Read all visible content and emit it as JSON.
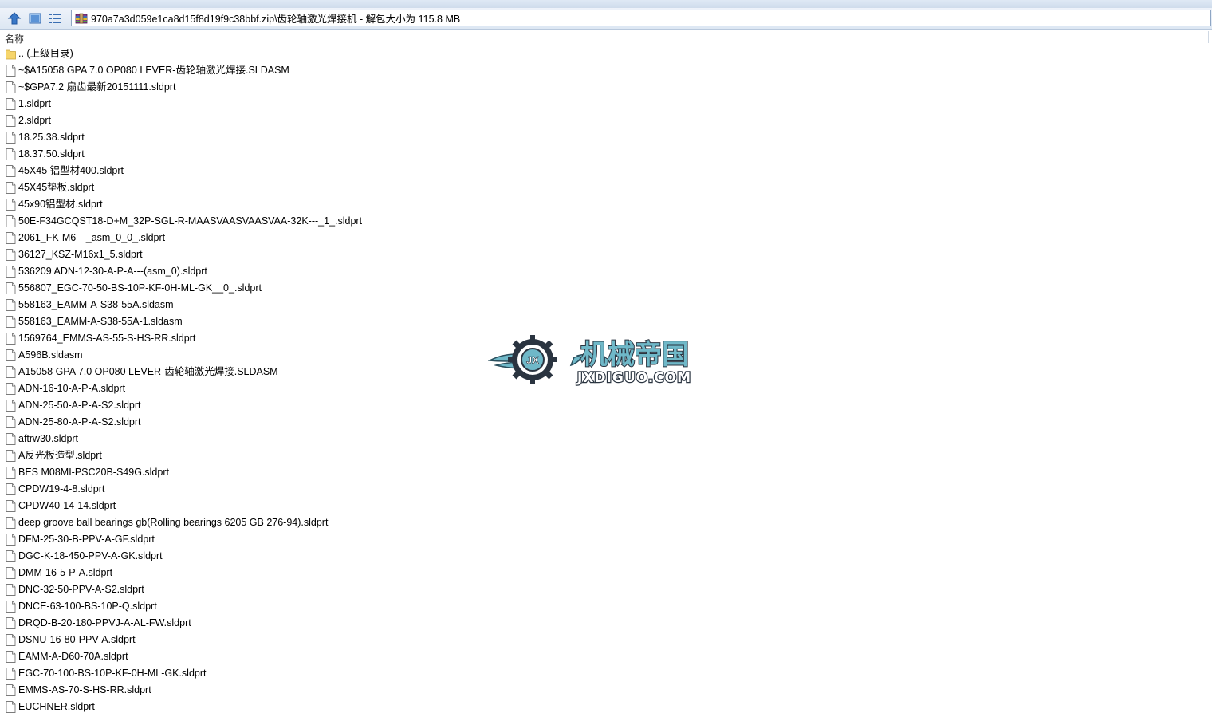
{
  "window": {
    "address_path": "970a7a3d059e1ca8d15f8d19f9c38bbf.zip\\齿轮轴激光焊接机 - 解包大小为 115.8 MB"
  },
  "list_header": {
    "name_column": "名称"
  },
  "files": [
    {
      "name": ".. (上级目录)",
      "type": "folder"
    },
    {
      "name": "~$A15058 GPA 7.0 OP080 LEVER-齿轮轴激光焊接.SLDASM",
      "type": "file"
    },
    {
      "name": "~$GPA7.2 扇齿最新20151111.sldprt",
      "type": "file"
    },
    {
      "name": "1.sldprt",
      "type": "file"
    },
    {
      "name": "2.sldprt",
      "type": "file"
    },
    {
      "name": "18.25.38.sldprt",
      "type": "file"
    },
    {
      "name": "18.37.50.sldprt",
      "type": "file"
    },
    {
      "name": "45X45 铝型材400.sldprt",
      "type": "file"
    },
    {
      "name": "45X45垫板.sldprt",
      "type": "file"
    },
    {
      "name": "45x90铝型材.sldprt",
      "type": "file"
    },
    {
      "name": "50E-F34GCQST18-D+M_32P-SGL-R-MAASVAASVAASVAA-32K---_1_.sldprt",
      "type": "file"
    },
    {
      "name": "2061_FK-M6---_asm_0_0_.sldprt",
      "type": "file"
    },
    {
      "name": "36127_KSZ-M16x1_5.sldprt",
      "type": "file"
    },
    {
      "name": "536209 ADN-12-30-A-P-A---(asm_0).sldprt",
      "type": "file"
    },
    {
      "name": "556807_EGC-70-50-BS-10P-KF-0H-ML-GK__0_.sldprt",
      "type": "file"
    },
    {
      "name": "558163_EAMM-A-S38-55A.sldasm",
      "type": "file"
    },
    {
      "name": "558163_EAMM-A-S38-55A-1.sldasm",
      "type": "file"
    },
    {
      "name": "1569764_EMMS-AS-55-S-HS-RR.sldprt",
      "type": "file"
    },
    {
      "name": "A596B.sldasm",
      "type": "file"
    },
    {
      "name": "A15058 GPA 7.0 OP080 LEVER-齿轮轴激光焊接.SLDASM",
      "type": "file"
    },
    {
      "name": "ADN-16-10-A-P-A.sldprt",
      "type": "file"
    },
    {
      "name": "ADN-25-50-A-P-A-S2.sldprt",
      "type": "file"
    },
    {
      "name": "ADN-25-80-A-P-A-S2.sldprt",
      "type": "file"
    },
    {
      "name": "aftrw30.sldprt",
      "type": "file"
    },
    {
      "name": "A反光板造型.sldprt",
      "type": "file"
    },
    {
      "name": "BES M08MI-PSC20B-S49G.sldprt",
      "type": "file"
    },
    {
      "name": "CPDW19-4-8.sldprt",
      "type": "file"
    },
    {
      "name": "CPDW40-14-14.sldprt",
      "type": "file"
    },
    {
      "name": "deep groove ball bearings gb(Rolling bearings 6205 GB 276-94).sldprt",
      "type": "file"
    },
    {
      "name": "DFM-25-30-B-PPV-A-GF.sldprt",
      "type": "file"
    },
    {
      "name": "DGC-K-18-450-PPV-A-GK.sldprt",
      "type": "file"
    },
    {
      "name": "DMM-16-5-P-A.sldprt",
      "type": "file"
    },
    {
      "name": "DNC-32-50-PPV-A-S2.sldprt",
      "type": "file"
    },
    {
      "name": "DNCE-63-100-BS-10P-Q.sldprt",
      "type": "file"
    },
    {
      "name": "DRQD-B-20-180-PPVJ-A-AL-FW.sldprt",
      "type": "file"
    },
    {
      "name": "DSNU-16-80-PPV-A.sldprt",
      "type": "file"
    },
    {
      "name": "EAMM-A-D60-70A.sldprt",
      "type": "file"
    },
    {
      "name": "EGC-70-100-BS-10P-KF-0H-ML-GK.sldprt",
      "type": "file"
    },
    {
      "name": "EMMS-AS-70-S-HS-RR.sldprt",
      "type": "file"
    },
    {
      "name": "EUCHNER.sldprt",
      "type": "file"
    }
  ],
  "watermark": {
    "title": "机械帝国",
    "domain": "JXDIGUO.COM",
    "badge": "JX"
  },
  "colors": {
    "folder": "#f6d56b",
    "accent_blue": "#3a78c7",
    "logo_teal": "#6fb8c8"
  },
  "icons": {
    "up": "up-arrow-icon",
    "view": "view-mode-icon",
    "details": "details-list-icon",
    "archive": "archive-icon",
    "file": "file-icon",
    "folder": "folder-icon"
  }
}
